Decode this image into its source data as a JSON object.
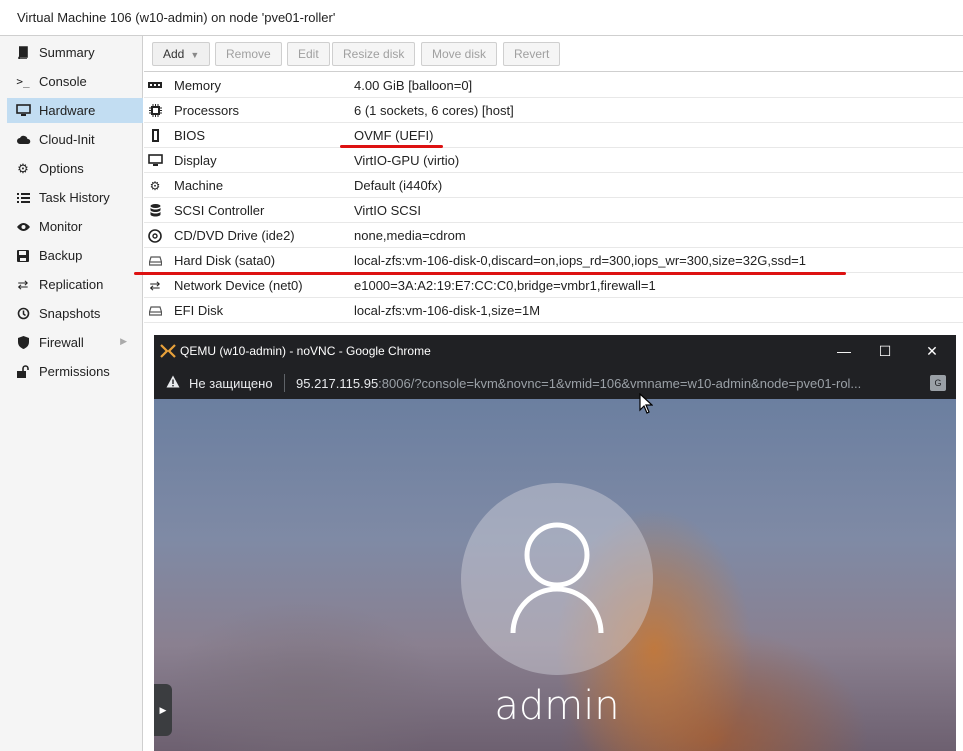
{
  "window_title": "Virtual Machine 106 (w10-admin) on node 'pve01-roller'",
  "sidebar": {
    "items": [
      {
        "label": "Summary",
        "icon": "book-icon"
      },
      {
        "label": "Console",
        "icon": "terminal-icon"
      },
      {
        "label": "Hardware",
        "icon": "monitor-icon",
        "active": true
      },
      {
        "label": "Cloud-Init",
        "icon": "cloud-icon"
      },
      {
        "label": "Options",
        "icon": "gear-icon"
      },
      {
        "label": "Task History",
        "icon": "list-icon"
      },
      {
        "label": "Monitor",
        "icon": "eye-icon"
      },
      {
        "label": "Backup",
        "icon": "floppy-icon"
      },
      {
        "label": "Replication",
        "icon": "retweet-icon"
      },
      {
        "label": "Snapshots",
        "icon": "history-icon"
      },
      {
        "label": "Firewall",
        "icon": "shield-icon"
      },
      {
        "label": "Permissions",
        "icon": "unlock-icon"
      }
    ]
  },
  "toolbar": {
    "add": "Add",
    "remove": "Remove",
    "edit": "Edit",
    "resize": "Resize disk",
    "move": "Move disk",
    "revert": "Revert"
  },
  "hardware": [
    {
      "key": "Memory",
      "value": "4.00 GiB [balloon=0]",
      "icon": "memory-icon"
    },
    {
      "key": "Processors",
      "value": "6 (1 sockets, 6 cores) [host]",
      "icon": "cpu-icon"
    },
    {
      "key": "BIOS",
      "value": "OVMF (UEFI)",
      "icon": "microchip-icon"
    },
    {
      "key": "Display",
      "value": "VirtIO-GPU (virtio)",
      "icon": "desktop-icon"
    },
    {
      "key": "Machine",
      "value": "Default (i440fx)",
      "icon": "cogs-icon"
    },
    {
      "key": "SCSI Controller",
      "value": "VirtIO SCSI",
      "icon": "database-icon"
    },
    {
      "key": "CD/DVD Drive (ide2)",
      "value": "none,media=cdrom",
      "icon": "disc-icon"
    },
    {
      "key": "Hard Disk (sata0)",
      "value": "local-zfs:vm-106-disk-0,discard=on,iops_rd=300,iops_wr=300,size=32G,ssd=1",
      "icon": "hdd-icon"
    },
    {
      "key": "Network Device (net0)",
      "value": "e1000=3A:A2:19:E7:CC:C0,bridge=vmbr1,firewall=1",
      "icon": "exchange-icon"
    },
    {
      "key": "EFI Disk",
      "value": "local-zfs:vm-106-disk-1,size=1M",
      "icon": "hdd-icon"
    }
  ],
  "chrome": {
    "title": "QEMU (w10-admin) - noVNC - Google Chrome",
    "not_secure": "Не защищено",
    "url_host": "95.217.115.95",
    "url_rest": ":8006/?console=kvm&novnc=1&vmid=106&vmname=w10-admin&node=pve01-rol..."
  },
  "vnc": {
    "username": "admin"
  },
  "colors": {
    "active_nav": "#c2ddf2",
    "annotation_red": "#dd1111",
    "chrome_dark": "#202124"
  }
}
